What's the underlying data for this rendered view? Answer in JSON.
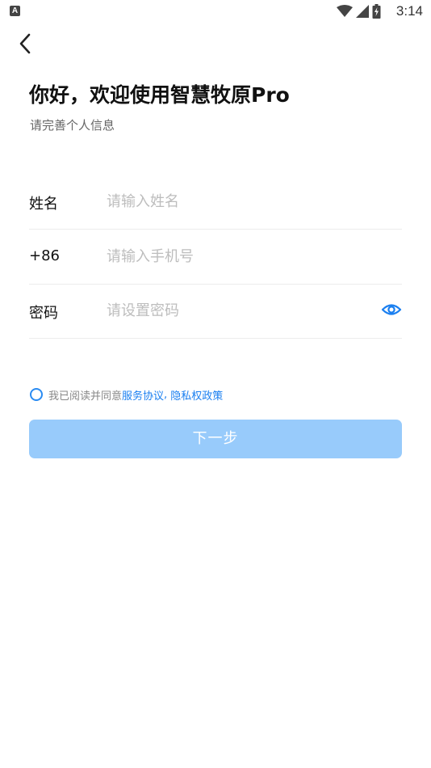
{
  "status_bar": {
    "app_badge": "A",
    "time": "3:14"
  },
  "header": {
    "title": "你好，欢迎使用智慧牧原Pro",
    "subtitle": "请完善个人信息"
  },
  "form": {
    "name_label": "姓名",
    "name_placeholder": "请输入姓名",
    "phone_label": "+86",
    "phone_placeholder": "请输入手机号",
    "password_label": "密码",
    "password_placeholder": "请设置密码"
  },
  "agreement": {
    "prefix": "我已阅读并同意",
    "service_link": "服务协议",
    "separator": ", ",
    "privacy_link": "隐私权政策"
  },
  "next_button": {
    "label": "下一步"
  },
  "colors": {
    "accent": "#2a8bf2",
    "link": "#1a7ff0",
    "button_disabled": "#98cbfb",
    "divider": "#ececec"
  },
  "icons": [
    "back-arrow-icon",
    "wifi-icon",
    "cellular-signal-icon",
    "battery-icon",
    "eye-icon",
    "radio-unchecked-icon"
  ]
}
